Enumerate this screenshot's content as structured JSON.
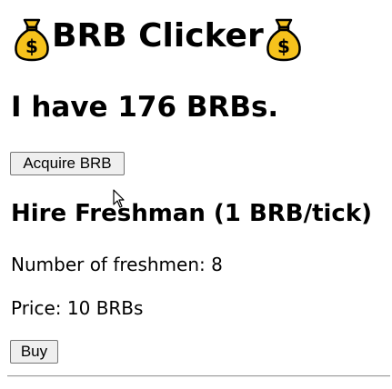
{
  "header": {
    "title": "BRB Clicker",
    "left_icon": "money-bag-icon",
    "right_icon": "money-bag-icon",
    "icon_color": "#f2b705"
  },
  "status": {
    "count_text": "I have 176 BRBs."
  },
  "actions": {
    "acquire_label": "Acquire BRB"
  },
  "upgrade": {
    "heading": "Hire Freshman (1 BRB/tick)",
    "owned_text": "Number of freshmen: 8",
    "price_text": "Price: 10 BRBs",
    "buy_label": "Buy"
  }
}
